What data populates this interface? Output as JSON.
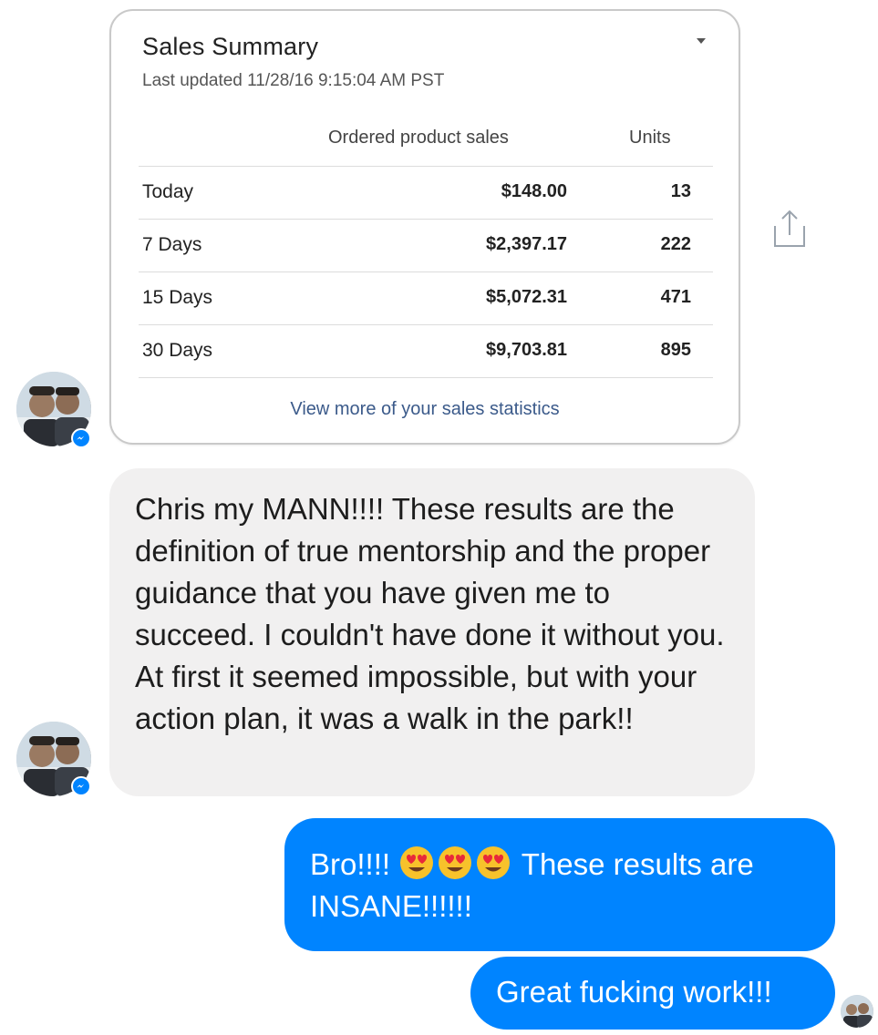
{
  "sales_summary": {
    "title": "Sales Summary",
    "last_updated": "Last updated 11/28/16 9:15:04 AM PST",
    "columns": {
      "sales": "Ordered product sales",
      "units": "Units"
    },
    "rows": [
      {
        "label": "Today",
        "sales": "$148.00",
        "units": "13"
      },
      {
        "label": "7 Days",
        "sales": "$2,397.17",
        "units": "222"
      },
      {
        "label": "15 Days",
        "sales": "$5,072.31",
        "units": "471"
      },
      {
        "label": "30 Days",
        "sales": "$9,703.81",
        "units": "895"
      }
    ],
    "view_more_link": "View more of your sales statistics"
  },
  "messages": {
    "incoming": "Chris my MANN!!!! These results are the definition of true mentorship and the proper guidance that you have given me to succeed. I couldn't have done it without you. At first it seemed impossible, but with your action plan, it was a walk in the park!!",
    "outgoing_1_prefix": "Bro!!!!",
    "outgoing_1_emojis": [
      "heart-eyes-emoji",
      "heart-eyes-emoji",
      "heart-eyes-emoji"
    ],
    "outgoing_1_suffix": "These results are INSANE!!!!!!",
    "outgoing_2": "Great fucking work!!!"
  },
  "icons": {
    "share": "share-icon",
    "caret": "chevron-down-icon",
    "badge": "messenger-icon"
  },
  "colors": {
    "outgoing_bubble": "#0084ff",
    "incoming_bubble": "#f1f0f0",
    "link": "#3b5a8a"
  }
}
